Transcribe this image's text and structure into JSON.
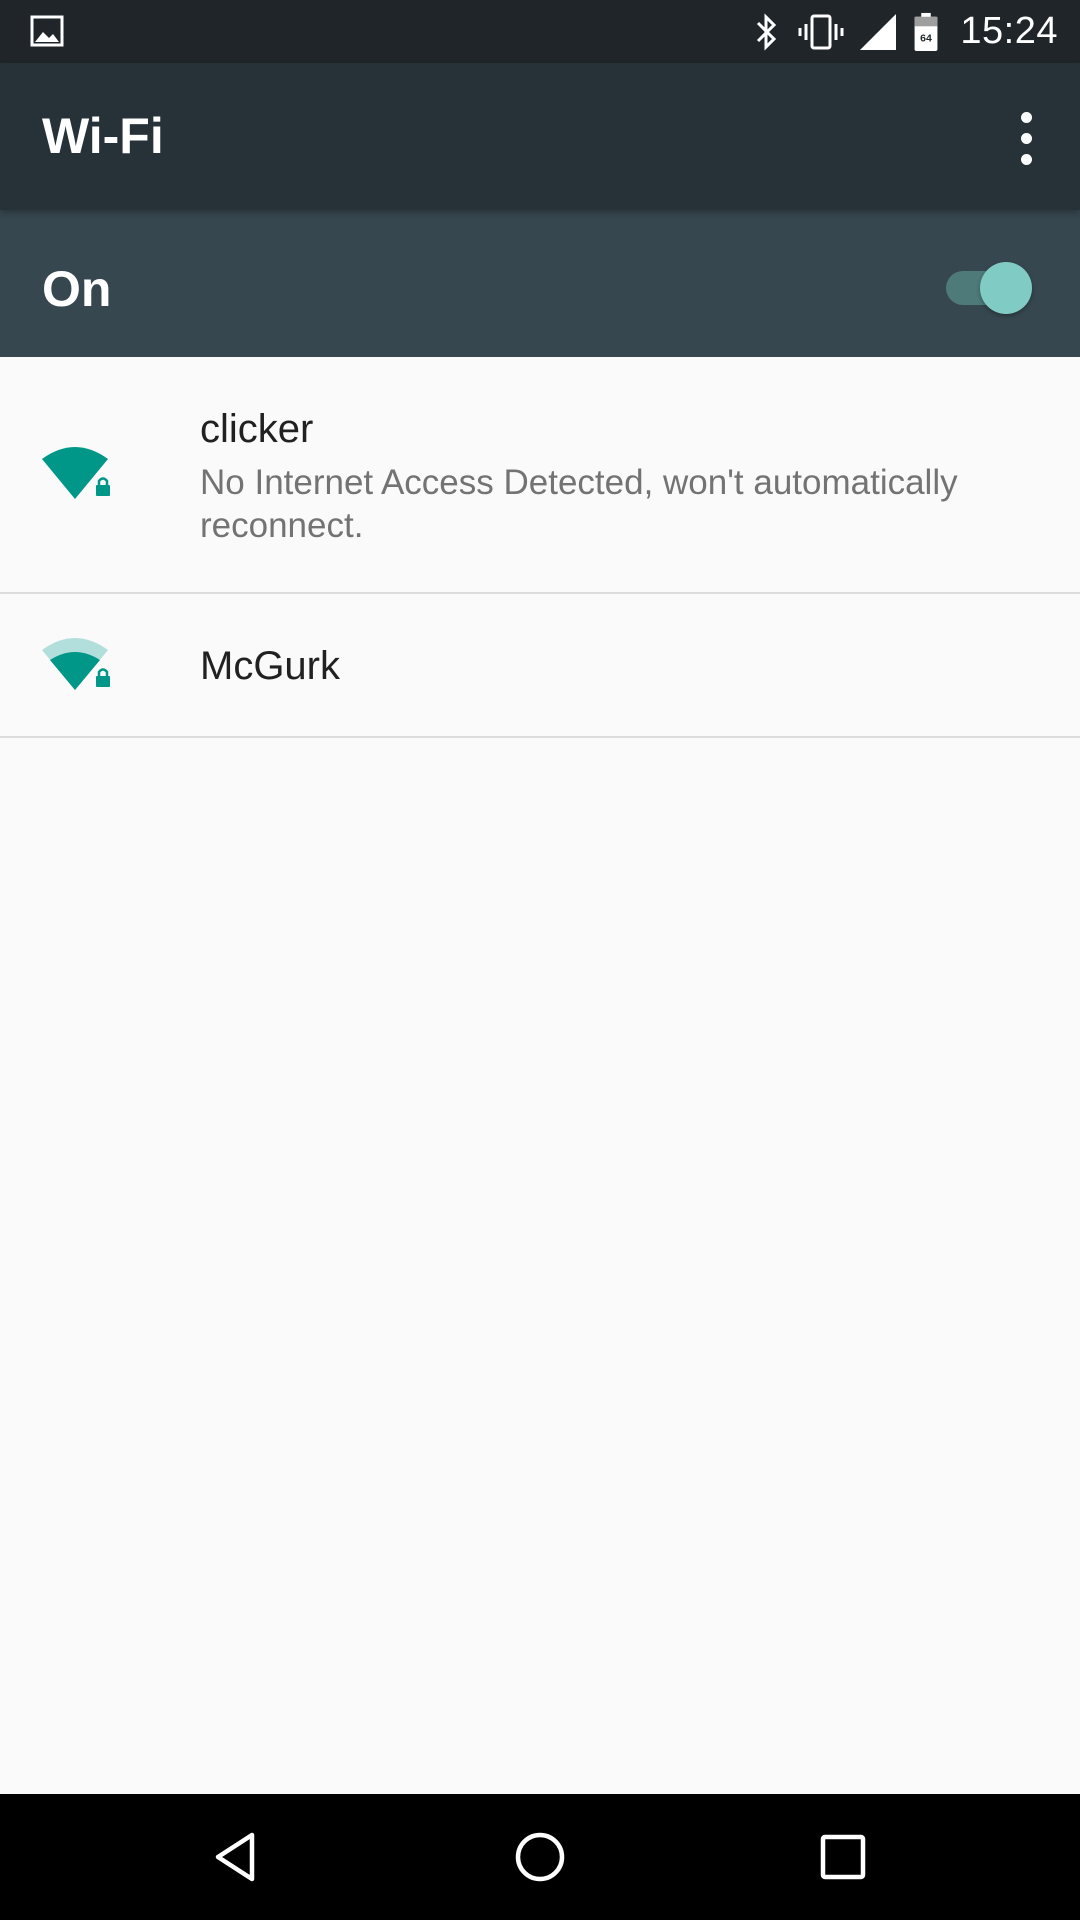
{
  "status_bar": {
    "time": "15:24",
    "battery_level": "64",
    "icons": [
      "image-notification-icon",
      "bluetooth-icon",
      "vibrate-icon",
      "signal-icon",
      "battery-icon"
    ]
  },
  "action_bar": {
    "title": "Wi-Fi",
    "overflow_icon": "more-vert-icon"
  },
  "switch_bar": {
    "label": "On",
    "checked": true
  },
  "networks": [
    {
      "ssid": "clicker",
      "summary": "No Internet Access Detected, won't automatically reconnect.",
      "secured": true,
      "signal_bars": 4
    },
    {
      "ssid": "McGurk",
      "summary": "",
      "secured": true,
      "signal_bars": 3
    }
  ],
  "nav_bar": {
    "buttons": [
      "back-icon",
      "home-icon",
      "recents-icon"
    ]
  },
  "colors": {
    "status_bar": "#1f2529",
    "action_bar": "#263238",
    "switch_bar": "#37474f",
    "accent": "#009688",
    "accent_light": "#80cbc4",
    "background": "#fafafa"
  }
}
